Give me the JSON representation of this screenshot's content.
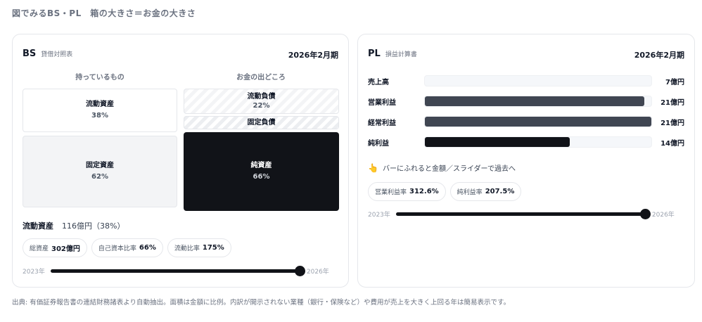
{
  "header": "図でみるBS・PL　箱の大きさ＝お金の大きさ",
  "bs": {
    "title": "BS",
    "subtitle": "貸借対照表",
    "period": "2026年2月期",
    "col_assets": "持っているもの",
    "col_liab": "お金の出どころ",
    "current_assets": {
      "label": "流動資産",
      "pct": "38%"
    },
    "fixed_assets": {
      "label": "固定資産",
      "pct": "62%"
    },
    "current_liab": {
      "label": "流動負債",
      "pct": "22%"
    },
    "fixed_liab": {
      "label": "固定負債"
    },
    "net_assets": {
      "label": "純資産",
      "pct": "66%"
    },
    "focus": {
      "name": "流動資産",
      "value": "116億円（38%）"
    },
    "pills": [
      {
        "label": "総資産",
        "value": "302億円"
      },
      {
        "label": "自己資本比率",
        "value": "66%"
      },
      {
        "label": "流動比率",
        "value": "175%"
      }
    ],
    "slider": {
      "start": "2023年",
      "end": "2026年"
    }
  },
  "pl": {
    "title": "PL",
    "subtitle": "損益計算書",
    "period": "2026年2月期",
    "rows": [
      {
        "label": "売上高",
        "value": "7億円",
        "fraction": 0.0,
        "color": "#f5f7fa"
      },
      {
        "label": "営業利益",
        "value": "21億円",
        "fraction": 0.97,
        "color": "#404652"
      },
      {
        "label": "経常利益",
        "value": "21億円",
        "fraction": 1.0,
        "color": "#404652"
      },
      {
        "label": "純利益",
        "value": "14億円",
        "fraction": 0.64,
        "color": "#111318"
      }
    ],
    "hint": "バーにふれると金額／スライダーで過去へ",
    "hint_icon": "pointing-hand-icon",
    "pills": [
      {
        "label": "営業利益率",
        "value": "312.6%"
      },
      {
        "label": "純利益率",
        "value": "207.5%"
      }
    ],
    "slider": {
      "start": "2023年",
      "end": "2026年"
    }
  },
  "footer": "出典: 有価証券報告書の連結財務諸表より自動抽出。面積は金額に比例。内訳が開示されない業種（銀行・保険など）や費用が売上を大きく上回る年は簡易表示です。"
}
